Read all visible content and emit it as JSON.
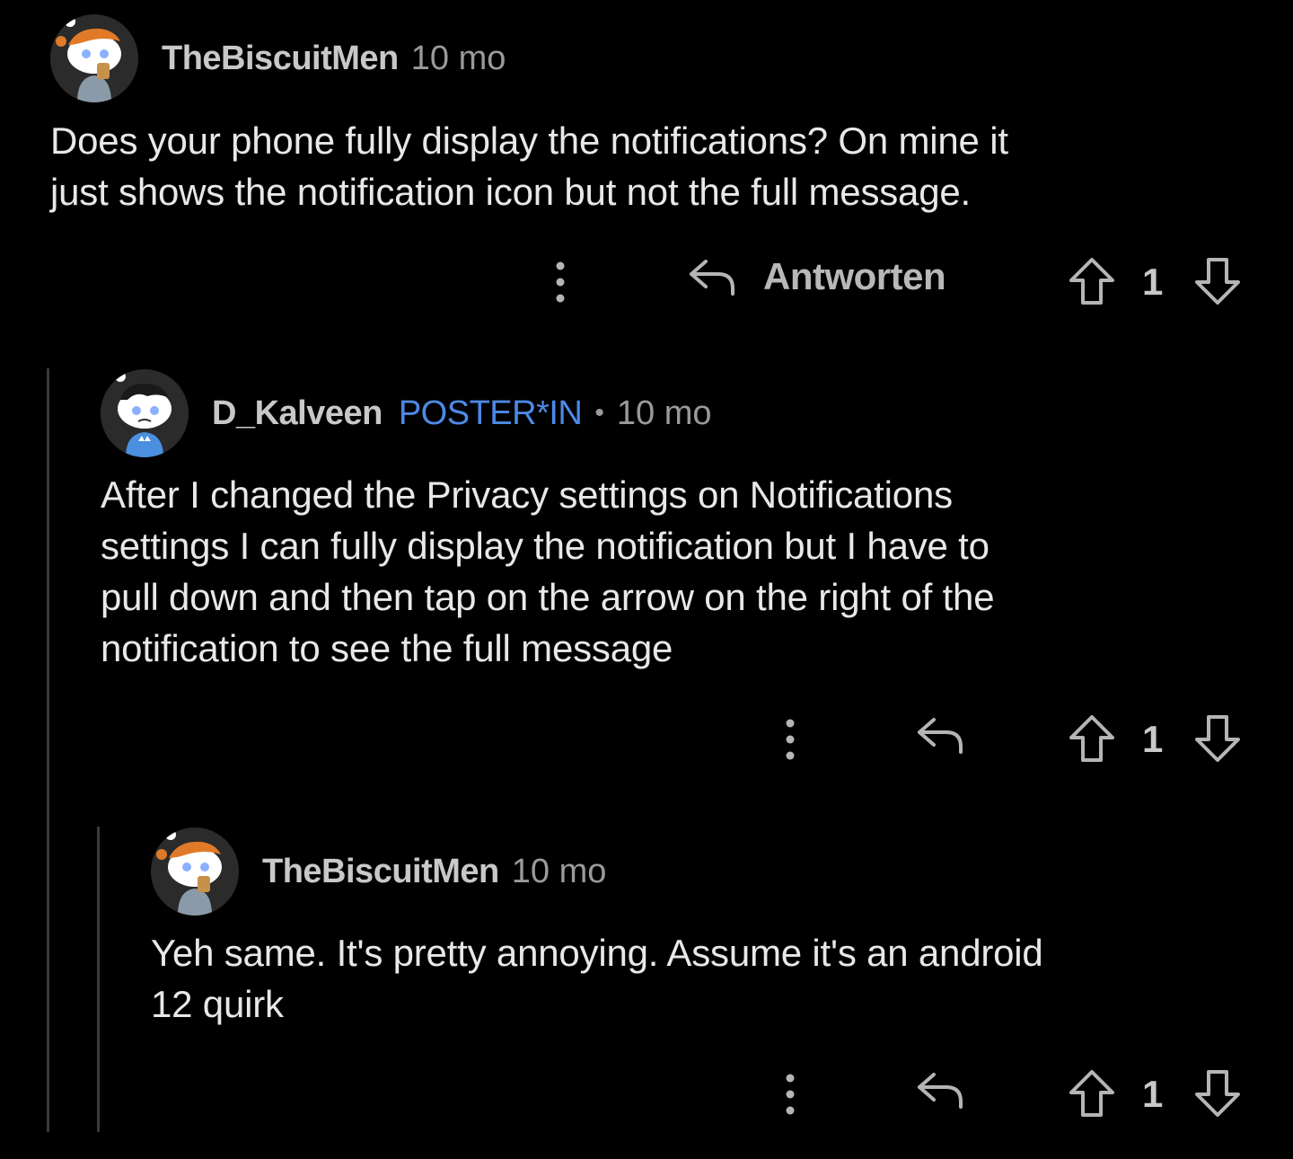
{
  "comments": [
    {
      "username": "TheBiscuitMen",
      "time": "10 mo",
      "body_lines": [
        "Does your phone fully display the notifications? On mine it",
        "just shows the notification icon but not the full message."
      ],
      "reply_label": "Antworten",
      "score": "1",
      "avatar_icon": "snoo-biscuit-avatar"
    },
    {
      "username": "D_Kalveen",
      "flair": "POSTER*IN",
      "separator": "•",
      "time": "10 mo",
      "body_lines": [
        "After I changed the Privacy settings on Notifications",
        "settings I can fully display the notification but I have to",
        "pull down and then tap on the arrow on the right of the",
        "notification to see the full message"
      ],
      "score": "1",
      "avatar_icon": "snoo-bunny-avatar"
    },
    {
      "username": "TheBiscuitMen",
      "time": "10 mo",
      "body_lines": [
        "Yeh same. It's pretty annoying. Assume it's an android",
        "12 quirk"
      ],
      "score": "1",
      "avatar_icon": "snoo-biscuit-avatar"
    }
  ],
  "colors": {
    "background": "#000000",
    "flair": "#4d8ae6",
    "thread_line": "#3a3a3a",
    "meta": "#9a9a9a"
  }
}
